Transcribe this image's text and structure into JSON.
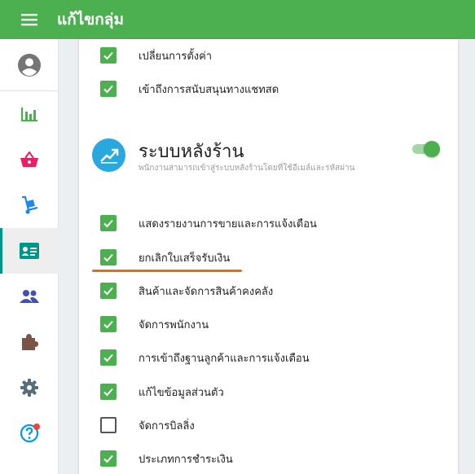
{
  "appbar": {
    "title": "แก้ไขกลุ่ม",
    "menu_icon": "hamburger-menu-icon"
  },
  "sidebar": {
    "items": [
      {
        "icon": "account-circle-icon"
      },
      {
        "icon": "bar-chart-icon"
      },
      {
        "icon": "basket-icon"
      },
      {
        "icon": "hand-truck-icon"
      },
      {
        "icon": "id-card-icon",
        "active": true
      },
      {
        "icon": "people-icon"
      },
      {
        "icon": "puzzle-icon"
      },
      {
        "icon": "gear-icon"
      },
      {
        "icon": "help-icon",
        "notification": true
      }
    ]
  },
  "permissions_top": [
    {
      "label": "เปลี่ยนการตั้งค่า",
      "checked": true
    },
    {
      "label": "เข้าถึงการสนับสนุนทางแชทสด",
      "checked": true
    }
  ],
  "backoffice": {
    "title": "ระบบหลังร้าน",
    "subtitle": "พนักงานสามารถเข้าสู่ระบบหลังร้านโดยที่ใช้อีเมล์และรหัสผ่าน",
    "enabled": true,
    "permissions": [
      {
        "label": "แสดงรายงานการขายและการแจ้งเตือน",
        "checked": true
      },
      {
        "label": "ยกเลิกใบเสร็จรับเงิน",
        "checked": true,
        "highlighted": true
      },
      {
        "label": "สินค้าและจัดการสินค้าคงคลัง",
        "checked": true
      },
      {
        "label": "จัดการพนักงาน",
        "checked": true
      },
      {
        "label": "การเข้าถึงฐานลูกค้าและการแจ้งเตือน",
        "checked": true
      },
      {
        "label": "แก้ไขข้อมูลส่วนตัว",
        "checked": true
      },
      {
        "label": "จัดการบิลลิ่ง",
        "checked": false
      },
      {
        "label": "ประเภทการชำระเงิน",
        "checked": true
      }
    ]
  },
  "colors": {
    "appbar": "#4caf50",
    "checkbox": "#4caf50",
    "active_indicator": "#009688",
    "highlight_underline": "#ef6c00",
    "section_icon_bg": "#29a8e0",
    "notification_dot": "#f44336"
  }
}
